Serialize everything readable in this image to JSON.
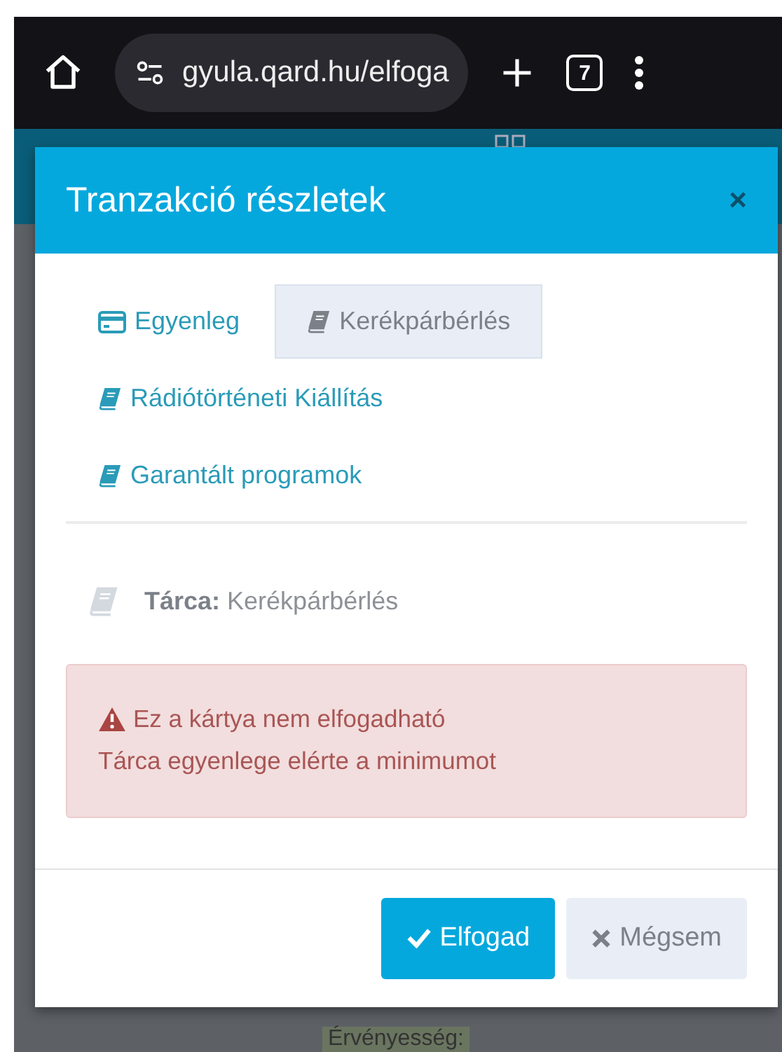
{
  "browser": {
    "url": "gyula.qard.hu/elfoga",
    "tab_count": "7"
  },
  "modal": {
    "title": "Tranzakció részletek",
    "close": "×",
    "tabs": [
      {
        "label": "Egyenleg",
        "kind": "card",
        "selected": false
      },
      {
        "label": "Kerékpárbérlés",
        "kind": "book",
        "selected": true
      },
      {
        "label": "Rádiótörténeti Kiállítás",
        "kind": "book",
        "selected": false
      },
      {
        "label": "Garantált programok",
        "kind": "book",
        "selected": false
      }
    ],
    "wallet": {
      "label": "Tárca:",
      "value": "Kerékpárbérlés"
    },
    "alert": {
      "lines": [
        "Ez a kártya nem elfogadható",
        "Tárca egyenlege elérte a minimumot"
      ]
    },
    "buttons": [
      {
        "label": "Elfogad",
        "kind": "primary"
      },
      {
        "label": "Mégsem",
        "kind": "secondary"
      }
    ]
  },
  "background_text": "Érvényesség:"
}
